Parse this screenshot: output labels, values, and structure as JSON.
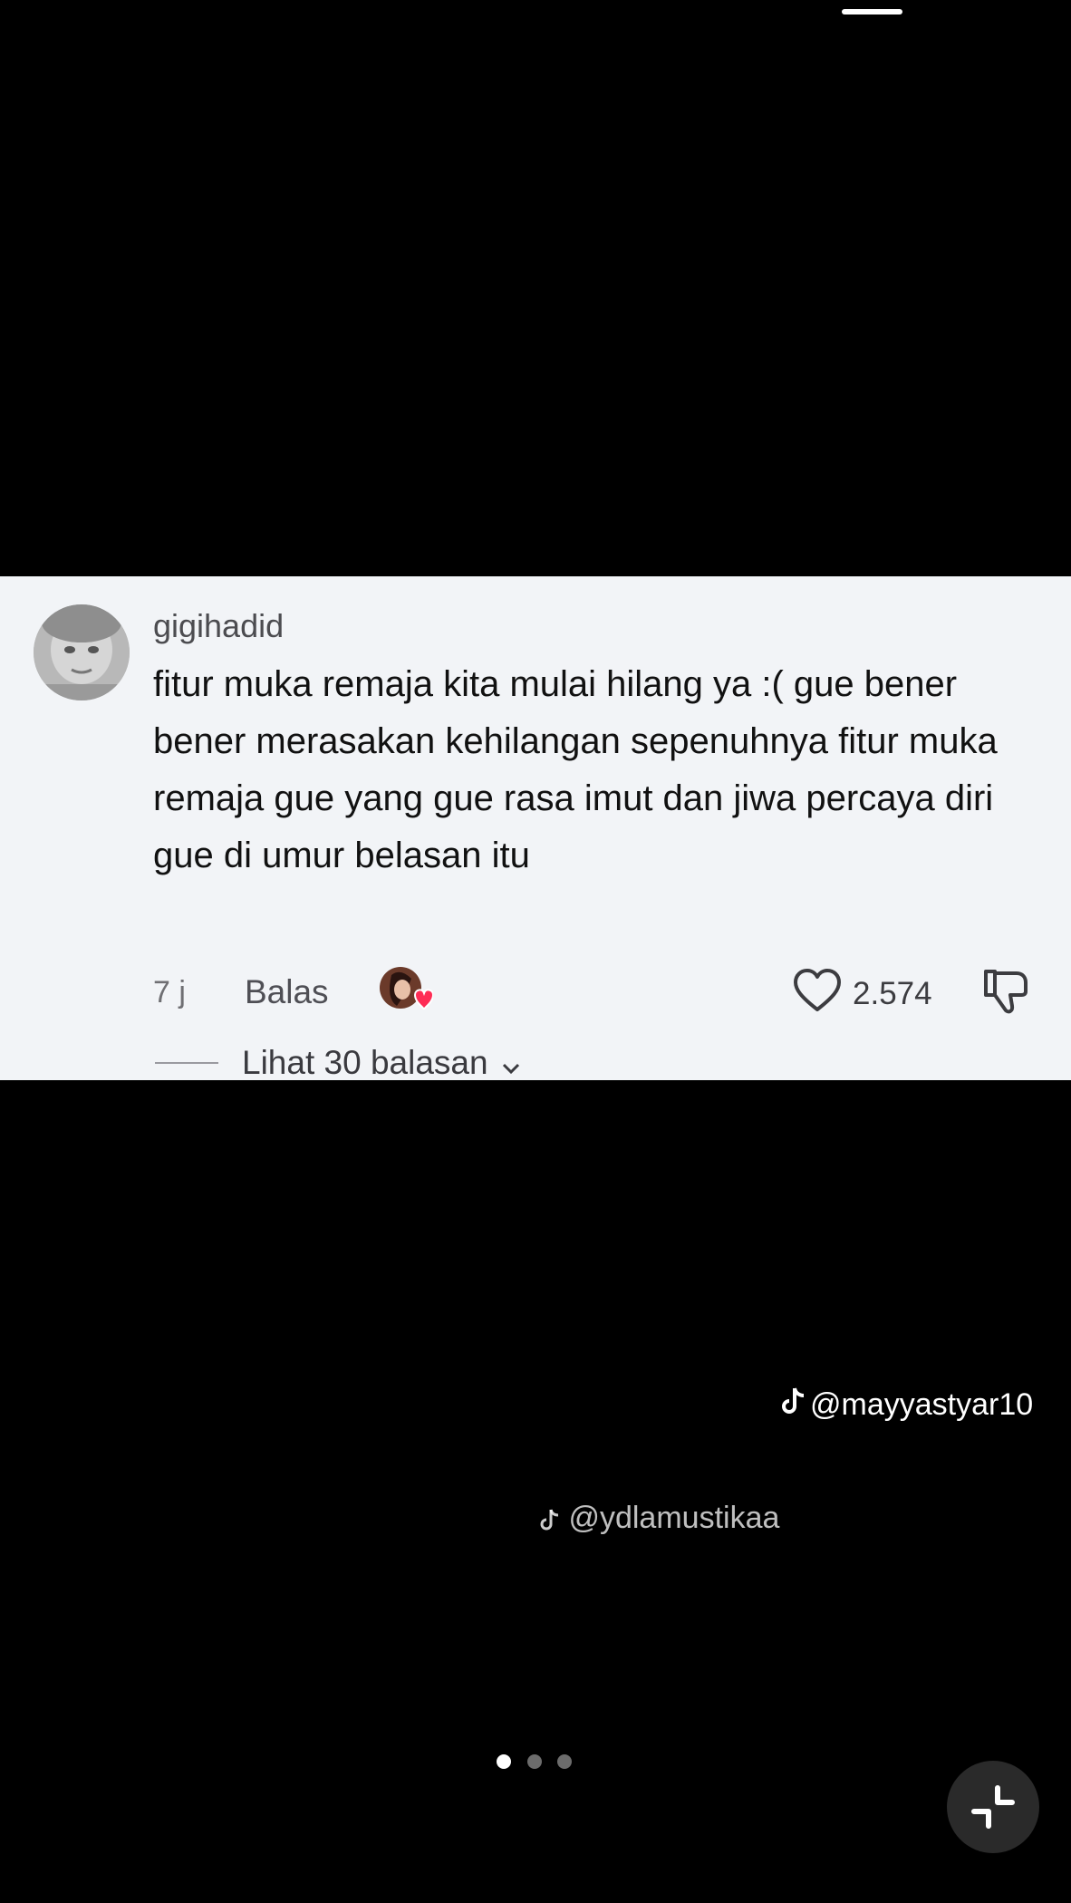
{
  "comment": {
    "username": "gigihadid",
    "text": "fitur muka remaja kita mulai hilang ya :( gue bener bener merasakan kehilangan sepenuhnya fitur muka remaja gue yang gue rasa imut dan jiwa percaya diri gue di umur belasan itu",
    "time": "7 j",
    "reply_label": "Balas",
    "like_count": "2.574",
    "view_replies_label": "Lihat 30 balasan"
  },
  "watermarks": {
    "inline": "@ydlamustikaa",
    "main": "@mayyastyar10"
  },
  "pager": {
    "count": 3,
    "active_index": 0
  },
  "icons": {
    "avatar": "user-avatar",
    "creator_like": "creator-liked-heart-icon",
    "like": "heart-outline-icon",
    "dislike": "thumbs-down-icon",
    "replies_chevron": "chevron-down-icon",
    "tiktok": "tiktok-logo-icon",
    "exit_fullscreen": "collapse-icon"
  },
  "colors": {
    "background": "#000000",
    "card": "#f2f4f7",
    "heart_badge": "#fe2c55"
  }
}
